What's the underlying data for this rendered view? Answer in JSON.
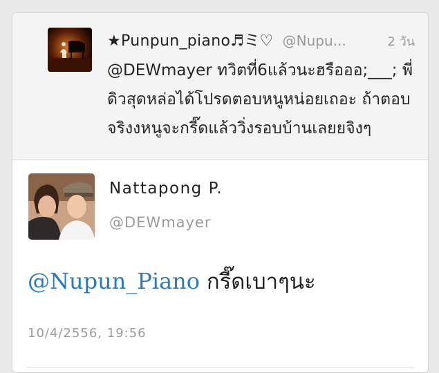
{
  "reply_tweet": {
    "display_name": "★Punpun_piano♬ミ♡",
    "handle": "@Nupu...",
    "time": "2 วัน",
    "text": "@DEWmayer ทวิตที่6แล้วนะฮรือออ;___; พี่ดิวสุดหล่อได้โปรดตอบหนูหน่อยเถอะ ถ้าตอบจริงงหนูจะกรี๊ดแล้ววิ่งรอบบ้านเลยยจิงๆ"
  },
  "main_tweet": {
    "display_name": "Nattapong P.",
    "handle": "@DEWmayer",
    "mention": "@Nupun_Piano",
    "text": " กรี๊ดเบาๆนะ",
    "date": "10/4/2556, 19:56"
  },
  "colors": {
    "mention": "#2b7bb9",
    "background": "#e9e9e9",
    "reply_background": "#f4f4f4"
  }
}
